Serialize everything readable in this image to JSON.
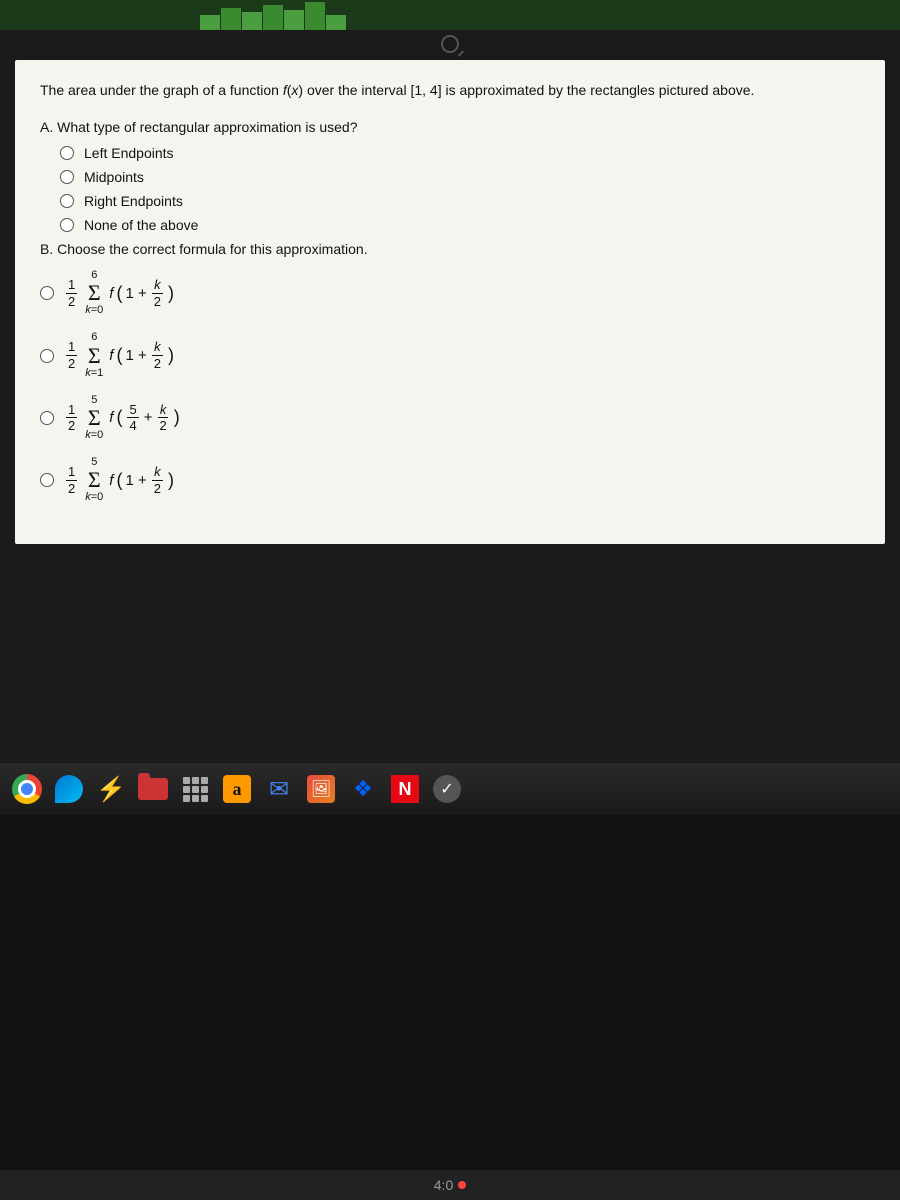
{
  "topChart": {
    "bars": [
      15,
      22,
      18,
      25,
      20,
      28,
      15
    ]
  },
  "searchIcon": "🔍",
  "questionA": {
    "intro": "The area under the graph of a function f(x) over the interval [1, 4] is approximated by the rectangles pictured above.",
    "label": "A. What type of rectangular approximation is used?",
    "options": [
      {
        "id": "left",
        "text": "Left Endpoints"
      },
      {
        "id": "mid",
        "text": "Midpoints"
      },
      {
        "id": "right",
        "text": "Right Endpoints"
      },
      {
        "id": "none",
        "text": "None of the above"
      }
    ]
  },
  "questionB": {
    "label": "B. Choose the correct formula for this approximation.",
    "options": [
      {
        "id": "opt1",
        "formula_desc": "(1/2) sum k=0 to 6 of f(1 + k/2)"
      },
      {
        "id": "opt2",
        "formula_desc": "(1/2) sum k=1 to 6 of f(1 + k/2)"
      },
      {
        "id": "opt3",
        "formula_desc": "(1/2) sum k=0 to 5 of f(5/4 + k/2)"
      },
      {
        "id": "opt4",
        "formula_desc": "(1/2) sum k=0 to 5 of f(1 + k/2)"
      }
    ]
  },
  "taskbar": {
    "icons": [
      {
        "name": "chrome",
        "label": "Google Chrome"
      },
      {
        "name": "edge",
        "label": "Microsoft Edge"
      },
      {
        "name": "lightning",
        "label": "App"
      },
      {
        "name": "folder",
        "label": "Folder"
      },
      {
        "name": "grid",
        "label": "Apps"
      },
      {
        "name": "amazon",
        "label": "Amazon"
      },
      {
        "name": "email",
        "label": "Email"
      },
      {
        "name": "photo",
        "label": "Photos"
      },
      {
        "name": "dropbox",
        "label": "Dropbox"
      },
      {
        "name": "netflix",
        "label": "Netflix"
      },
      {
        "name": "check",
        "label": "Check"
      }
    ]
  },
  "statusBar": {
    "time": "4:0",
    "hasNotification": true
  }
}
